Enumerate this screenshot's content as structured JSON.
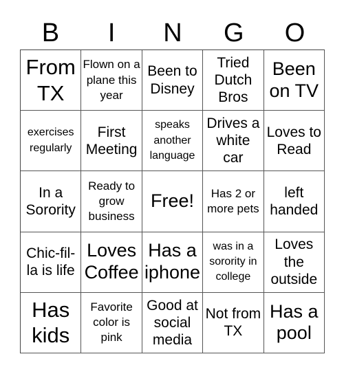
{
  "header": [
    "B",
    "I",
    "N",
    "G",
    "O"
  ],
  "cells": [
    {
      "text": "From TX",
      "size": "s1"
    },
    {
      "text": "Flown on a plane this year",
      "size": "s4"
    },
    {
      "text": "Been to Disney",
      "size": "s3"
    },
    {
      "text": "Tried Dutch Bros",
      "size": "s3"
    },
    {
      "text": "Been on TV",
      "size": "s2"
    },
    {
      "text": "exercises regularly",
      "size": "s5"
    },
    {
      "text": "First Meeting",
      "size": "s3"
    },
    {
      "text": "speaks another language",
      "size": "s5"
    },
    {
      "text": "Drives a white car",
      "size": "s3"
    },
    {
      "text": "Loves to Read",
      "size": "s3"
    },
    {
      "text": "In a Sorority",
      "size": "s3"
    },
    {
      "text": "Ready to grow business",
      "size": "s4"
    },
    {
      "text": "Free!",
      "size": "s2"
    },
    {
      "text": "Has 2 or more pets",
      "size": "s4"
    },
    {
      "text": "left handed",
      "size": "s3"
    },
    {
      "text": "Chic-fil-la is life",
      "size": "s3"
    },
    {
      "text": "Loves Coffee",
      "size": "s2"
    },
    {
      "text": "Has a iphone",
      "size": "s2"
    },
    {
      "text": "was in a sorority in college",
      "size": "s5"
    },
    {
      "text": "Loves the outside",
      "size": "s3"
    },
    {
      "text": "Has kids",
      "size": "s1"
    },
    {
      "text": "Favorite color is pink",
      "size": "s4"
    },
    {
      "text": "Good at social media",
      "size": "s3"
    },
    {
      "text": "Not from TX",
      "size": "s3"
    },
    {
      "text": "Has a pool",
      "size": "s2"
    }
  ]
}
